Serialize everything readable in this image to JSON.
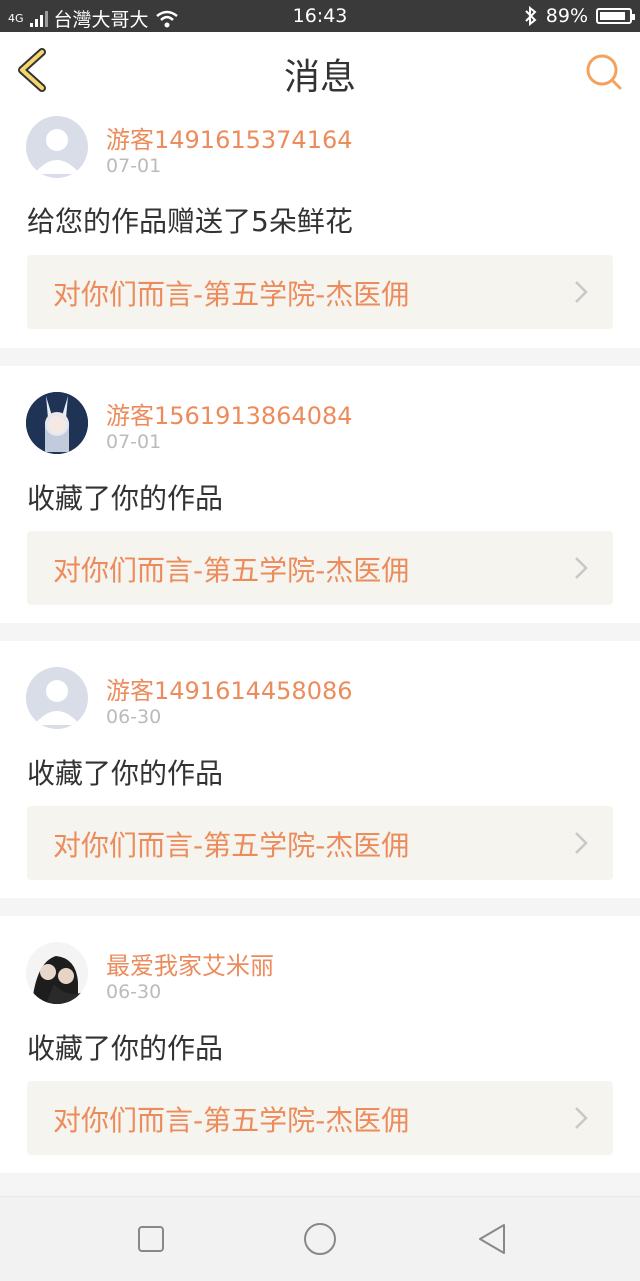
{
  "status_bar": {
    "network": "4G",
    "carrier": "台灣大哥大",
    "time": "16:43",
    "battery": "89%",
    "battery_level": 0.89
  },
  "header": {
    "title": "消息",
    "back_icon": "chevron-left-icon",
    "search_icon": "search-icon",
    "accent": "#f3a35d"
  },
  "messages": [
    {
      "user": "游客1491615374164",
      "date": "07-01",
      "action": "给您的作品赠送了5朵鲜花",
      "work_title": "对你们而言-第五学院-杰医佣",
      "avatar": "default-avatar"
    },
    {
      "user": "游客1561913864084",
      "date": "07-01",
      "action": "收藏了你的作品",
      "work_title": "对你们而言-第五学院-杰医佣",
      "avatar": "anime-avatar"
    },
    {
      "user": "游客1491614458086",
      "date": "06-30",
      "action": "收藏了你的作品",
      "work_title": "对你们而言-第五学院-杰医佣",
      "avatar": "default-avatar"
    },
    {
      "user": "最爱我家艾米丽",
      "date": "06-30",
      "action": "收藏了你的作品",
      "work_title": "对你们而言-第五学院-杰医佣",
      "avatar": "photo-avatar"
    }
  ],
  "colors": {
    "username": "#ec8c5c",
    "work_title": "#ec8c5c",
    "work_bg": "#f5f4ee",
    "date": "#bbbbbb"
  },
  "nav_bar": [
    "square-icon",
    "circle-icon",
    "triangle-back-icon"
  ]
}
